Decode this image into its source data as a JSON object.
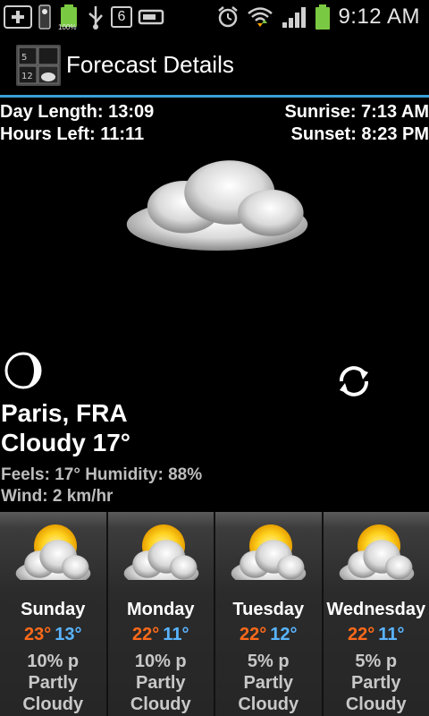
{
  "status_bar": {
    "battery_small_label": "100%",
    "notification_count": "6",
    "time": "9:12 AM",
    "icons": [
      "add-icon",
      "phone-icon",
      "battery-small-icon",
      "usb-icon",
      "notification-count-icon",
      "tablet-icon",
      "alarm-icon",
      "wifi-icon",
      "signal-icon",
      "battery-icon"
    ]
  },
  "header": {
    "title": "Forecast Details"
  },
  "summary": {
    "day_length": "Day Length: 13:09",
    "hours_left": "Hours Left: 11:11",
    "sunrise": "Sunrise: 7:13 AM",
    "sunset": "Sunset: 8:23 PM"
  },
  "current": {
    "location": "Paris, FRA",
    "condition": "Cloudy 17°",
    "feels_humidity": "Feels: 17° Humidity: 88%",
    "wind": "Wind: 2 km/hr",
    "icons": [
      "cloud-icon",
      "moon-phase-icon",
      "refresh-icon"
    ]
  },
  "forecast": [
    {
      "day": "Sunday",
      "high": "23°",
      "low": "13°",
      "precip": "10% p",
      "cond1": "Partly",
      "cond2": "Cloudy"
    },
    {
      "day": "Monday",
      "high": "22°",
      "low": "11°",
      "precip": "10% p",
      "cond1": "Partly",
      "cond2": "Cloudy"
    },
    {
      "day": "Tuesday",
      "high": "22°",
      "low": "12°",
      "precip": "5% p",
      "cond1": "Partly",
      "cond2": "Cloudy"
    },
    {
      "day": "Wednesday",
      "high": "22°",
      "low": "11°",
      "precip": "5% p",
      "cond1": "Partly",
      "cond2": "Cloudy"
    }
  ],
  "colors": {
    "accent": "#3aa0d8",
    "high_temp": "#ff6a1a",
    "low_temp": "#5ab4ff"
  }
}
